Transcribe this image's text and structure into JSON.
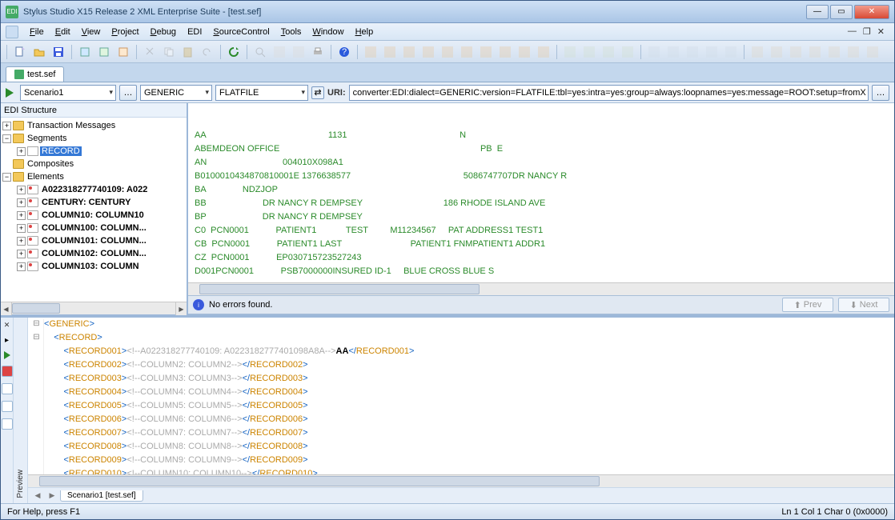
{
  "title": "Stylus Studio X15 Release 2 XML Enterprise Suite - [test.sef]",
  "menu": {
    "file": "File",
    "edit": "Edit",
    "view": "View",
    "project": "Project",
    "debug": "Debug",
    "edi": "EDI",
    "source": "SourceControl",
    "tools": "Tools",
    "window": "Window",
    "help": "Help"
  },
  "tab": {
    "name": "test.sef"
  },
  "scenario": {
    "name": "Scenario1",
    "dialect": "GENERIC",
    "format": "FLATFILE",
    "uriLabel": "URI:",
    "uri": "converter:EDI:dialect=GENERIC:version=FLATFILE:tbl=yes:intra=yes:group=always:loopnames=yes:message=ROOT:setup=fromX"
  },
  "tree": {
    "header": "EDI Structure",
    "tm": "Transaction Messages",
    "segments": "Segments",
    "record": "RECORD",
    "composites": "Composites",
    "elements": "Elements",
    "e1": "A022318277740109: A022",
    "e2": "CENTURY: CENTURY",
    "e3": "COLUMN10: COLUMN10",
    "e4": "COLUMN100: COLUMN...",
    "e5": "COLUMN101: COLUMN...",
    "e6": "COLUMN102: COLUMN...",
    "e7": "COLUMN103: COLUMN"
  },
  "flat": [
    "AA                                                  1131                                              N",
    "ABEMDEON OFFICE                                                                                  PB  E",
    "AN                               004010X098A1",
    "B0100010434870810001E 1376638577                                              5086747707DR NANCY R",
    "BA               NDZJOP",
    "BB                       DR NANCY R DEMPSEY                                 186 RHODE ISLAND AVE",
    "BP                       DR NANCY R DEMPSEY",
    "C0  PCN0001           PATIENT1            TEST         M11234567     PAT ADDRESS1 TEST1",
    "CB  PCN0001           PATIENT1 LAST                            PATIENT1 FNMPATIENT1 ADDR1",
    "CZ  PCN0001           EP030715723527243",
    "D001PCN0001           PSB7000000INSURED ID-1     BLUE CROSS BLUE S"
  ],
  "errors": {
    "msg": "No errors found.",
    "prev": "Prev",
    "next": "Next"
  },
  "xml": {
    "root": "GENERIC",
    "rec": "RECORD",
    "r": [
      {
        "t": "RECORD001",
        "c": "A022318277740109: A0223182777401098A8A",
        "v": "AA"
      },
      {
        "t": "RECORD002",
        "c": "COLUMN2: COLUMN2",
        "v": ""
      },
      {
        "t": "RECORD003",
        "c": "COLUMN3: COLUMN3",
        "v": ""
      },
      {
        "t": "RECORD004",
        "c": "COLUMN4: COLUMN4",
        "v": ""
      },
      {
        "t": "RECORD005",
        "c": "COLUMN5: COLUMN5",
        "v": ""
      },
      {
        "t": "RECORD006",
        "c": "COLUMN6: COLUMN6",
        "v": ""
      },
      {
        "t": "RECORD007",
        "c": "COLUMN7: COLUMN7",
        "v": ""
      },
      {
        "t": "RECORD008",
        "c": "COLUMN8: COLUMN8",
        "v": ""
      },
      {
        "t": "RECORD009",
        "c": "COLUMN9: COLUMN9",
        "v": ""
      },
      {
        "t": "RECORD010",
        "c": "COLUMN10: COLUMN10",
        "v": ""
      }
    ]
  },
  "bottomTab": "Scenario1 [test.sef]",
  "preview": "Preview",
  "status": {
    "help": "For Help, press F1",
    "pos": "Ln 1 Col 1  Char 0 (0x0000)"
  }
}
